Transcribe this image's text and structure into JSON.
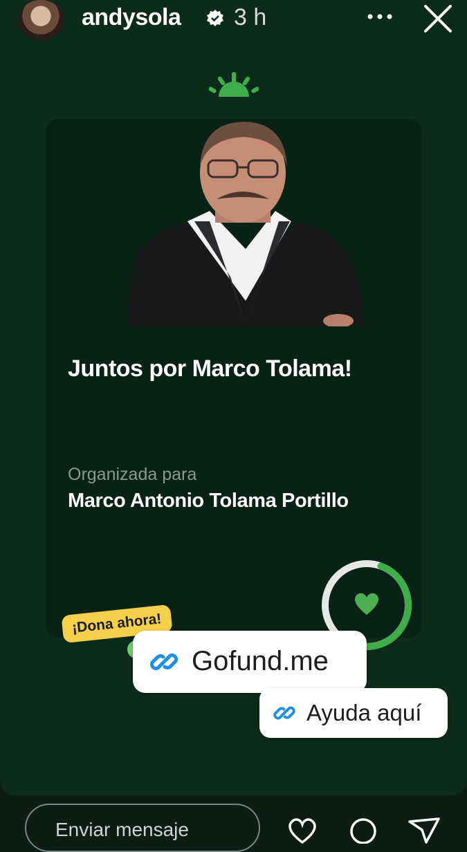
{
  "header": {
    "username": "andysola",
    "time": "3 h"
  },
  "card": {
    "title": "Juntos por Marco Tolama!",
    "organized_label": "Organizada para",
    "organized_name": "Marco Antonio Tolama Portillo",
    "progress_fraction": 0.45
  },
  "stickers": {
    "donate": "¡Dona ahora!",
    "link1": "Gofund.me",
    "link2": "Ayuda aquí"
  },
  "reply": {
    "placeholder": "Enviar mensaje"
  },
  "colors": {
    "background": "#0d2b1b",
    "card": "#082215",
    "accent_green": "#4caf50",
    "sticker_yellow": "#f5d04a",
    "link_blue": "#1d8fe6"
  },
  "icons": [
    "verified-icon",
    "more-icon",
    "close-icon",
    "sun-logo-icon",
    "heart-icon",
    "link-icon",
    "like-icon",
    "message-icon",
    "send-icon"
  ]
}
